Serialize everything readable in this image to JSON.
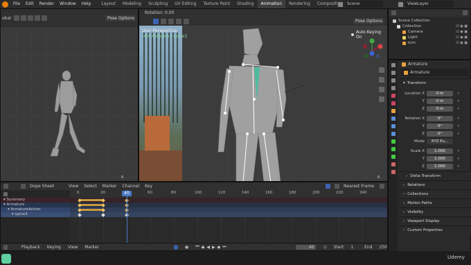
{
  "topbar": {
    "menu": [
      "File",
      "Edit",
      "Render",
      "Window",
      "Help"
    ],
    "workspaces": [
      "Layout",
      "Modeling",
      "Sculpting",
      "UV Editing",
      "Texture Paint",
      "Shading",
      "Animation",
      "Rendering",
      "Compositing",
      "Geome"
    ],
    "active_workspace": "Animation",
    "scene": "Scene",
    "view_layer": "ViewLayer"
  },
  "left_viewport": {
    "mode_label": "obal",
    "pose_options": "Pose Options",
    "camera_letter": "R"
  },
  "center_viewport": {
    "rotation": "Rotation: 0.00",
    "pose_options": "Pose Options",
    "view_name": "User Perspective",
    "object_info": "(40) Rotation | spine3",
    "auto_keying": "Auto Keying On",
    "camera_letter": "R"
  },
  "outliner": {
    "items": [
      {
        "label": "Scene Collection"
      },
      {
        "label": "Collection"
      },
      {
        "label": "Camera"
      },
      {
        "label": "Light"
      },
      {
        "label": "tom"
      }
    ]
  },
  "properties": {
    "object_name": "Armature",
    "data_name": "Armature",
    "transform_label": "Transform",
    "location": {
      "label": "Location X",
      "x": "0 m",
      "y": "0 m",
      "z": "0 m"
    },
    "rotation": {
      "label": "Rotation X",
      "x": "0°",
      "y": "0°",
      "z": "0°"
    },
    "mode_label": "Mode",
    "mode_value": "XYZ Eu...",
    "scale": {
      "label": "Scale X",
      "x": "1.000",
      "y": "1.000",
      "z": "1.000"
    },
    "axis_labels": [
      "Y",
      "Z"
    ],
    "sections": [
      "Delta Transform",
      "Relations",
      "Collections",
      "Motion Paths",
      "Visibility",
      "Viewport Display",
      "Custom Properties"
    ]
  },
  "dopesheet": {
    "editor_label": "Dope Sheet",
    "menus": [
      "View",
      "Select",
      "Marker",
      "Channel",
      "Key"
    ],
    "interpolation": "Nearest Frame",
    "channels": [
      "Summary",
      "Armature",
      "ArmatureAction",
      "spine3"
    ],
    "ticks": [
      0,
      20,
      40,
      60,
      80,
      100,
      120,
      140,
      160,
      180,
      200,
      220,
      240
    ],
    "current_frame_label": "40",
    "keyframes": [
      0,
      20,
      40
    ]
  },
  "footer": {
    "menus": [
      "Playback",
      "Keying",
      "View",
      "Marker"
    ],
    "frame": "40",
    "start_label": "Start",
    "start": "1",
    "end_label": "End",
    "end": "250"
  },
  "watermark": "Udemy",
  "colors": {
    "accent": "#3e63b5",
    "keyframe": "#e8c060",
    "summary_bg": "#3a2127",
    "armature_bg": "#26354e",
    "action_bg": "#33456a",
    "bone_bg": "#3b5076"
  }
}
